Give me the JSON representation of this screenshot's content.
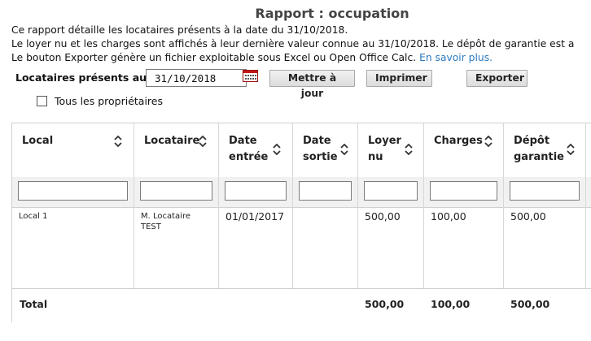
{
  "page": {
    "title": "Rapport : occupation",
    "intro_lines": [
      "Ce rapport détaille les locataires présents à la date du 31/10/2018.",
      "Le loyer nu et les charges sont affichés à leur dernière valeur connue au 31/10/2018. Le dépôt de garantie est a",
      "Le bouton Exporter génère un fichier exploitable sous Excel ou Open Office Calc."
    ],
    "learn_more": "En savoir plus."
  },
  "filters": {
    "label": "Locataires présents au",
    "date_value": "31/10/2018",
    "update_label": "Mettre à jour",
    "print_label": "Imprimer",
    "export_label": "Exporter",
    "all_owners_label": "Tous les propriétaires",
    "all_owners_checked": false
  },
  "table": {
    "headers": [
      {
        "line1": "Local",
        "line2": ""
      },
      {
        "line1": "Locataire",
        "line2": ""
      },
      {
        "line1": "Date",
        "line2": "entrée"
      },
      {
        "line1": "Date",
        "line2": "sortie"
      },
      {
        "line1": "Loyer",
        "line2": "nu"
      },
      {
        "line1": "Charges",
        "line2": ""
      },
      {
        "line1": "Dépôt",
        "line2": "garantie"
      }
    ],
    "rows": [
      {
        "local": "Local 1",
        "locataire_line1": "M. Locataire",
        "locataire_line2": "TEST",
        "date_entree": "01/01/2017",
        "date_sortie": "",
        "loyer": "500,00",
        "charges": "100,00",
        "depot": "500,00"
      }
    ],
    "total": {
      "label": "Total",
      "loyer": "500,00",
      "charges": "100,00",
      "depot": "500,00"
    }
  }
}
